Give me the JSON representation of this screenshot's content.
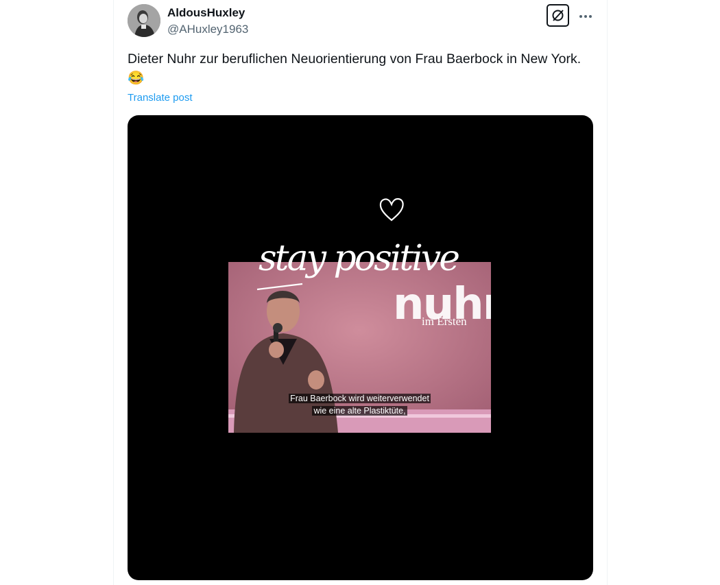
{
  "post": {
    "display_name": "AldousHuxley",
    "handle": "@AHuxley1963",
    "text": "Dieter Nuhr zur beruflichen Neuorientierung von Frau Baerbock in New York. 😂",
    "translate_label": "Translate post"
  },
  "media": {
    "overlay_script": "stay positive",
    "logo_text": "nuhr",
    "logo_subtext": "im Ersten",
    "subtitle_line1": "Frau Baerbock wird weiterverwendet",
    "subtitle_line2": "wie eine alte Plastiktüte,"
  },
  "icons": {
    "grok": "grok-icon",
    "more": "more-horizontal-icon",
    "heart": "heart-outline-icon"
  },
  "colors": {
    "link": "#1d9bf0",
    "secondary_text": "#536471",
    "media_background": "#000000"
  }
}
